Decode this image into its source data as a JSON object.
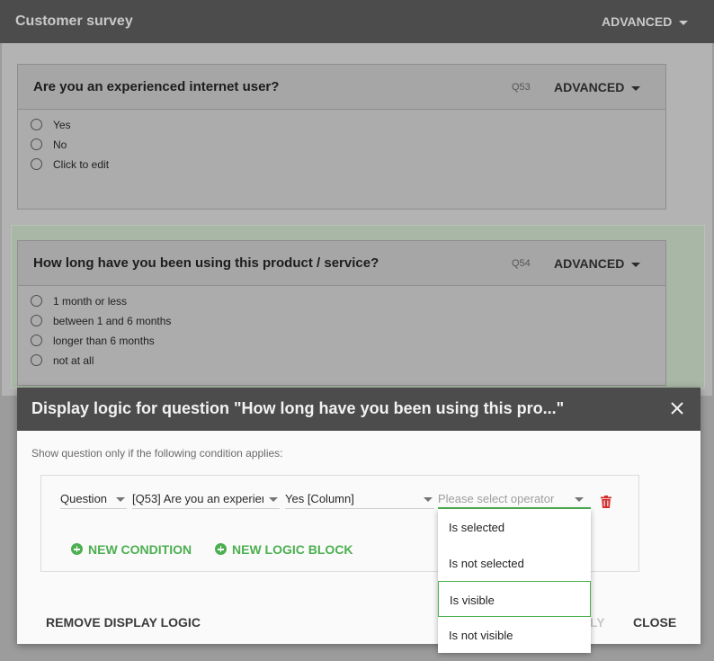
{
  "app": {
    "title": "Customer survey",
    "advanced_label": "ADVANCED"
  },
  "questions": [
    {
      "title": "Are you an experienced internet user?",
      "id": "Q53",
      "advanced_label": "ADVANCED",
      "options": [
        "Yes",
        "No",
        "Click to edit"
      ]
    },
    {
      "title": "How long have you been using this product / service?",
      "id": "Q54",
      "advanced_label": "ADVANCED",
      "options": [
        "1 month or less",
        "between 1 and 6 months",
        "longer than 6 months",
        "not at all"
      ]
    }
  ],
  "dialog": {
    "title": "Display logic for question \"How long have you been using this pro...\"",
    "subtitle": "Show question only if the following condition applies:",
    "condition": {
      "type_value": "Question",
      "question_value": "[Q53] Are you an experien",
      "column_value": "Yes [Column]",
      "operator_placeholder": "Please select operator"
    },
    "new_condition_label": "NEW CONDITION",
    "new_logic_block_label": "NEW LOGIC BLOCK",
    "remove_label": "REMOVE DISPLAY LOGIC",
    "apply_label": "LY",
    "close_label": "CLOSE"
  },
  "operator_menu": {
    "items": [
      "Is selected",
      "Is not selected",
      "Is visible",
      "Is not visible"
    ],
    "highlighted_index": 2
  },
  "colors": {
    "accent": "#4caf50",
    "header": "#4c4c4c",
    "delete": "#d32f2f"
  }
}
